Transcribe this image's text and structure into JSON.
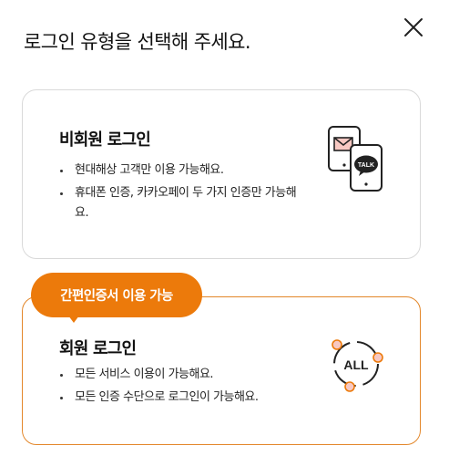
{
  "header": {
    "title": "로그인 유형을 선택해 주세요."
  },
  "guest": {
    "title": "비회원 로그인",
    "bullets": [
      "현대해상 고객만 이용 가능해요.",
      "휴대폰 인증, 카카오페이 두 가지 인증만 가능해요."
    ],
    "icon_text": "TALK"
  },
  "member": {
    "badge": "간편인증서 이용 가능",
    "title": "회원 로그인",
    "bullets": [
      "모든 서비스 이용이 가능해요.",
      "모든 인증 수단으로 로그인이 가능해요."
    ],
    "icon_text": "ALL"
  },
  "colors": {
    "accent": "#ec7a0b",
    "border_default": "#d9d9d9",
    "icon_fill_red": "#f7c8c2"
  },
  "icons": {
    "close": "close-icon",
    "guest": "phone-mail-talk-icon",
    "member": "all-auth-icon"
  }
}
